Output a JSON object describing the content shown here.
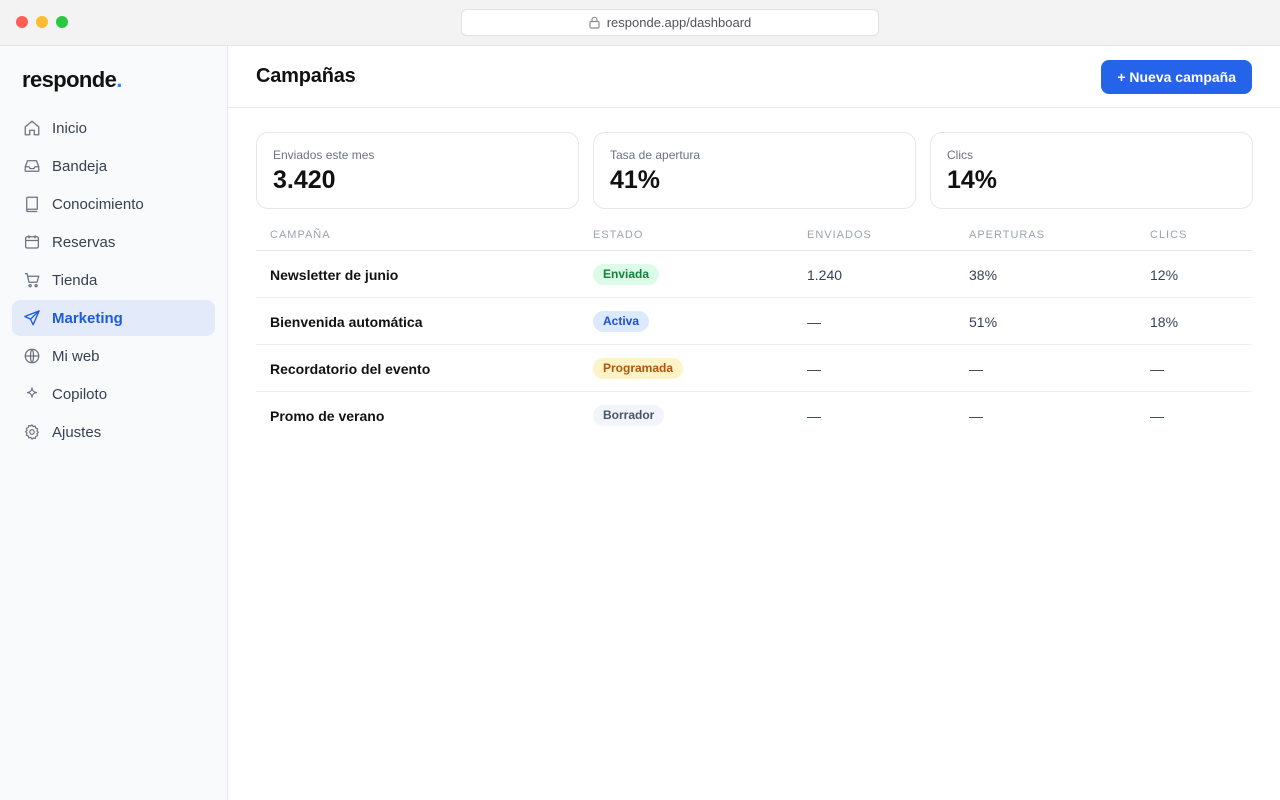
{
  "browser": {
    "url": "responde.app/dashboard"
  },
  "sidebar": {
    "logo": "responde",
    "logo_dot": ".",
    "items": [
      {
        "label": "Inicio",
        "icon": "home-icon"
      },
      {
        "label": "Bandeja",
        "icon": "inbox-icon"
      },
      {
        "label": "Conocimiento",
        "icon": "book-icon"
      },
      {
        "label": "Reservas",
        "icon": "calendar-icon"
      },
      {
        "label": "Tienda",
        "icon": "cart-icon"
      },
      {
        "label": "Marketing",
        "icon": "send-icon",
        "active": true
      },
      {
        "label": "Mi web",
        "icon": "globe-icon"
      },
      {
        "label": "Copiloto",
        "icon": "sparkle-icon"
      },
      {
        "label": "Ajustes",
        "icon": "gear-icon"
      }
    ]
  },
  "header": {
    "title": "Campañas",
    "new_button": "+ Nueva campaña"
  },
  "stats": [
    {
      "label": "Enviados este mes",
      "value": "3.420"
    },
    {
      "label": "Tasa de apertura",
      "value": "41%"
    },
    {
      "label": "Clics",
      "value": "14%"
    }
  ],
  "table": {
    "headers": [
      "CAMPAÑA",
      "ESTADO",
      "ENVIADOS",
      "APERTURAS",
      "CLICS"
    ],
    "rows": [
      {
        "name": "Newsletter de junio",
        "status": "Enviada",
        "sent": "1.240",
        "opens": "38%",
        "clicks": "12%"
      },
      {
        "name": "Bienvenida automática",
        "status": "Activa",
        "sent": "—",
        "opens": "51%",
        "clicks": "18%"
      },
      {
        "name": "Recordatorio del evento",
        "status": "Programada",
        "sent": "—",
        "opens": "—",
        "clicks": "—"
      },
      {
        "name": "Promo de verano",
        "status": "Borrador",
        "sent": "—",
        "opens": "—",
        "clicks": "—"
      }
    ]
  },
  "colors": {
    "accent": "#2563eb",
    "status_enviada_bg": "#dcfce7",
    "status_enviada_fg": "#15803d",
    "status_activa_bg": "#dbeafe",
    "status_activa_fg": "#1d4ed8",
    "status_programada_bg": "#fef3c7",
    "status_programada_fg": "#b45309",
    "status_borrador_bg": "#f1f5f9",
    "status_borrador_fg": "#475569"
  }
}
